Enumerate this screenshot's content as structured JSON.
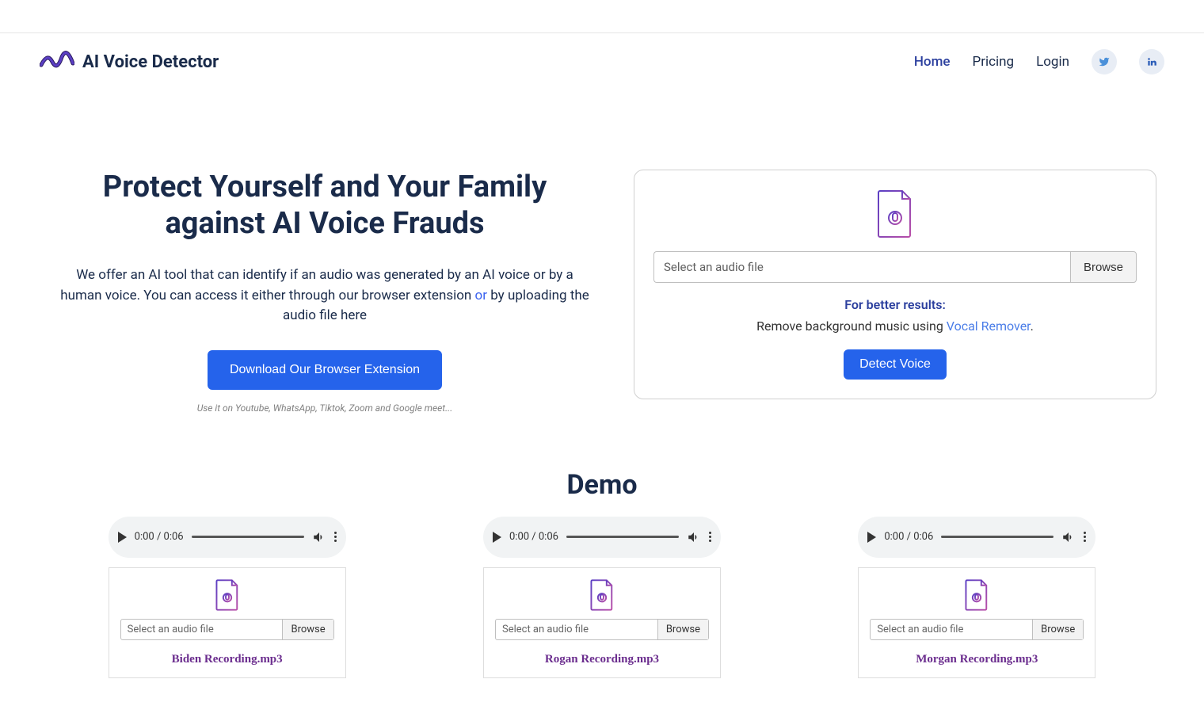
{
  "brand": "AI Voice Detector",
  "nav": {
    "home": "Home",
    "pricing": "Pricing",
    "login": "Login"
  },
  "hero": {
    "title": "Protect Yourself and Your Family against AI Voice Frauds",
    "desc_pre": "We offer an AI tool that can identify if an audio was generated by an AI voice or by a human voice. You can access it either through our browser extension ",
    "desc_or": "or",
    "desc_post": " by uploading the audio file here",
    "cta": "Download Our Browser Extension",
    "cta_hint": "Use it on Youtube, WhatsApp, Tiktok, Zoom and Google meet..."
  },
  "upload": {
    "placeholder": "Select an audio file",
    "browse": "Browse",
    "results_title": "For better results:",
    "results_text_pre": "Remove background music using ",
    "results_link": "Vocal Remover",
    "results_text_post": ".",
    "detect": "Detect Voice"
  },
  "demo": {
    "title": "Demo",
    "audio_time": "0:00 / 0:06",
    "items": [
      {
        "placeholder": "Select an audio file",
        "browse": "Browse",
        "label": "Biden Recording.mp3"
      },
      {
        "placeholder": "Select an audio file",
        "browse": "Browse",
        "label": "Rogan Recording.mp3"
      },
      {
        "placeholder": "Select an audio file",
        "browse": "Browse",
        "label": "Morgan Recording.mp3"
      }
    ]
  }
}
